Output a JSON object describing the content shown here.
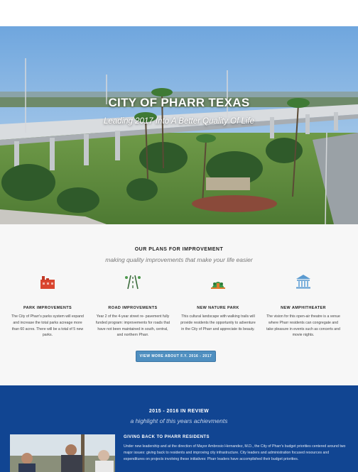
{
  "hero": {
    "title": "CITY OF PHARR TEXAS",
    "subtitle": "Leading 2017 Into A Better Quality Of Life"
  },
  "plans": {
    "title": "OUR PLANS FOR IMPROVEMENT",
    "subtitle": "making quality improvements that make your life easier",
    "items": [
      {
        "icon": "factory-icon",
        "heading": "PARK IMPROVEMENTS",
        "text": "The City of Pharr's parks system will expand and increase the total parks acreage more than 60 acres. There will be a total of 5 new parks."
      },
      {
        "icon": "road-icon",
        "heading": "ROAD IMPROVEMENTS",
        "text": "Year 2 of the 4-year street re- pavement fully funded program: improvements for roads that have not been maintained in south, central, and northern Pharr."
      },
      {
        "icon": "park-icon",
        "heading": "NEW NATURE PARK",
        "text": "This cultural landscape with walking trails will provide residents the opportunity to adventure in the City of Pharr and appreciate its beauty."
      },
      {
        "icon": "amphitheater-icon",
        "heading": "NEW AMPHITHEATER",
        "text": "The vision for this open-air theatre is a venue where Pharr residents can congregate and take pleasure in events such as concerts and movie nights."
      }
    ],
    "button_label": "VIEW MORE ABOUT F.Y. 2016 - 2017"
  },
  "review": {
    "title": "2015 - 2016 IN REVIEW",
    "subtitle": "a highlight of this years achievments",
    "heading": "GIVING BACK TO PHARR RESIDENTS",
    "body": "Under new leadership and at the direction of Mayor Ambrosio Hernandez, M.D., the City of Pharr's budget priorities centered around two major issues: giving back to residents and improving city infrastructure. City leaders and administration focused resources and expenditures on projects involving these initiatives: Pharr leaders have accomplished their budget priorities."
  },
  "colors": {
    "button": "#4f8fc0",
    "review_bg": "#114592",
    "plans_bg": "#f7f7f7"
  }
}
